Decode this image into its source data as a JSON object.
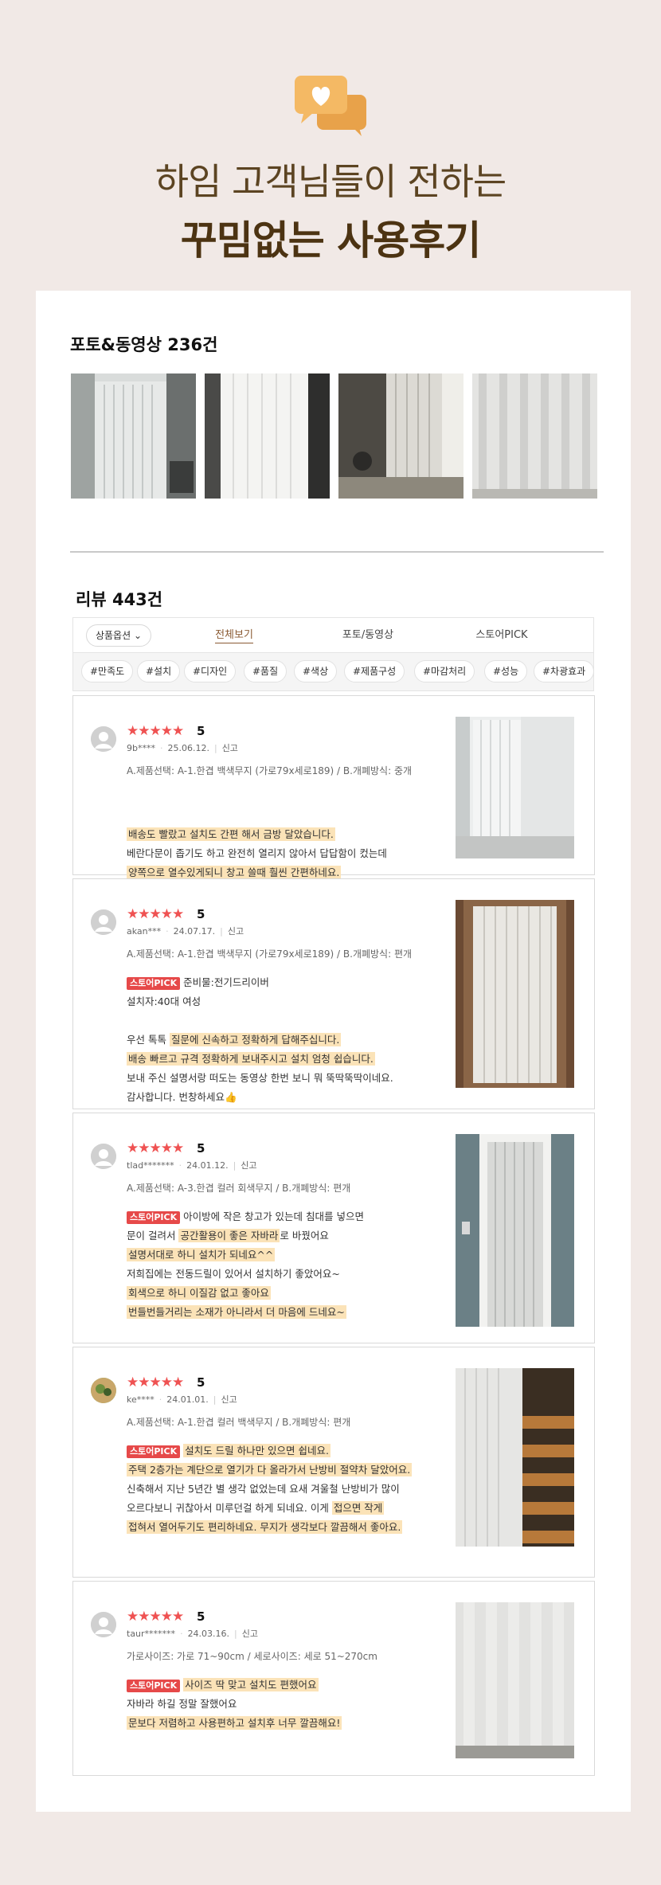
{
  "header": {
    "line1": "하임 고객님들이 전하는",
    "line2": "꾸밈없는 사용후기",
    "icon": "chat-heart-icon",
    "accent": "#f2b055"
  },
  "photos": {
    "label": "포토&동영상",
    "count": "236건"
  },
  "reviews_section": {
    "label": "리뷰",
    "count": "443건",
    "option_button": "상품옵션",
    "tabs": [
      "전체보기",
      "포토/동영상",
      "스토어PICK"
    ],
    "tags": [
      "#만족도",
      "#설치",
      "#디자인",
      "#품질",
      "#색상",
      "#제품구성",
      "#마감처리",
      "#성능",
      "#차광효과"
    ]
  },
  "reviews": [
    {
      "stars": "★★★★★",
      "score": "5",
      "user": "9b****",
      "date": "25.06.12.",
      "report": "신고",
      "option": "A.제품선택: A-1.한겹 백색무지 (가로79x세로189) / B.개폐방식: 중개",
      "lines": [
        {
          "pick": "",
          "parts": [
            {
              "t": "배송도 빨랐고 설치도 간편",
              "h": true
            },
            {
              "t": "해서 금방 달았습니다.",
              "h": true
            }
          ]
        },
        {
          "pick": "",
          "parts": [
            {
              "t": "베란다문이 좁기도 하고 완전히 열리지 않아서 답답함이 컸는데",
              "h": false
            }
          ]
        },
        {
          "pick": "",
          "parts": [
            {
              "t": "양쪽으로 열수있게되니 창고 쓸때 훨씬 간편하네요.",
              "h": true
            }
          ]
        }
      ]
    },
    {
      "stars": "★★★★★",
      "score": "5",
      "user": "akan***",
      "date": "24.07.17.",
      "report": "신고",
      "option": "A.제품선택: A-1.한겹 백색무지 (가로79x세로189) / B.개폐방식: 편개",
      "lines": [
        {
          "pick": "스토어PICK",
          "parts": [
            {
              "t": "준비물:전기드리이버",
              "h": false
            }
          ]
        },
        {
          "pick": "",
          "parts": [
            {
              "t": "설치자:40대 여성",
              "h": false
            }
          ]
        },
        {
          "pick": "",
          "parts": [
            {
              "t": "",
              "h": false
            }
          ]
        },
        {
          "pick": "",
          "parts": [
            {
              "t": "우선 톡톡 ",
              "h": false
            },
            {
              "t": "질문에 신속하고 정확하게 답해주십니다.",
              "h": true
            }
          ]
        },
        {
          "pick": "",
          "parts": [
            {
              "t": "배송 빠르고 규격 정확하게 보내주시고 설치 엄청 쉽습니다.",
              "h": true
            }
          ]
        },
        {
          "pick": "",
          "parts": [
            {
              "t": "보내 주신 설명서랑 떠도는 동영상 한번 보니 뭐 뚝딱뚝딱이네요.",
              "h": false
            }
          ]
        },
        {
          "pick": "",
          "parts": [
            {
              "t": "감사합니다. 번창하세요👍",
              "h": false
            }
          ]
        }
      ]
    },
    {
      "stars": "★★★★★",
      "score": "5",
      "user": "tlad*******",
      "date": "24.01.12.",
      "report": "신고",
      "option": "A.제품선택: A-3.한겹 컬러 회색무지 / B.개폐방식: 편개",
      "lines": [
        {
          "pick": "스토어PICK",
          "parts": [
            {
              "t": "아이방에 작은 창고가 있는데 침대를 넣으면",
              "h": false
            }
          ]
        },
        {
          "pick": "",
          "parts": [
            {
              "t": "문이 걸려서 ",
              "h": false
            },
            {
              "t": "공간활용이 좋은 자바라",
              "h": true
            },
            {
              "t": "로 바꿨어요",
              "h": false
            }
          ]
        },
        {
          "pick": "",
          "parts": [
            {
              "t": "설명서대로 하니 설치가 되네요^^",
              "h": true
            }
          ]
        },
        {
          "pick": "",
          "parts": [
            {
              "t": "저희집에는 전동드릴이 있어서 설치하기 좋았어요~",
              "h": false
            }
          ]
        },
        {
          "pick": "",
          "parts": [
            {
              "t": "회색으로 하니 이질감 없고 좋아요",
              "h": true
            }
          ]
        },
        {
          "pick": "",
          "parts": [
            {
              "t": "번들번들거리는 소재가 아니라서 더 마음에 드네요~",
              "h": true
            }
          ]
        }
      ]
    },
    {
      "stars": "★★★★★",
      "score": "5",
      "user": "ke****",
      "date": "24.01.01.",
      "report": "신고",
      "option": "A.제품선택: A-1.한겹 컬러 백색무지 / B.개폐방식: 편개",
      "lines": [
        {
          "pick": "스토어PICK",
          "parts": [
            {
              "t": "설치도 드릴 하나만 있으면 쉽네요.",
              "h": true
            }
          ]
        },
        {
          "pick": "",
          "parts": [
            {
              "t": "주택 2층가는 계단으로 열기가 다 올라가서 난방비 절약차 달았어요.",
              "h": true
            }
          ]
        },
        {
          "pick": "",
          "parts": [
            {
              "t": "신축해서 지난 5년간 별 생각 없었는데 요새 겨울철 난방비가 많이",
              "h": false
            }
          ]
        },
        {
          "pick": "",
          "parts": [
            {
              "t": "오르다보니 귀찮아서 미루던걸 하게 되네요. 이게 ",
              "h": false
            },
            {
              "t": "접으면 작게",
              "h": true
            }
          ]
        },
        {
          "pick": "",
          "parts": [
            {
              "t": "접혀서 열어두기도 편리하네요. 무지가 생각보다 깔끔해서 좋아요.",
              "h": true
            }
          ]
        }
      ]
    },
    {
      "stars": "★★★★★",
      "score": "5",
      "user": "taur*******",
      "date": "24.03.16.",
      "report": "신고",
      "option": "가로사이즈: 가로 71~90cm / 세로사이즈: 세로 51~270cm",
      "lines": [
        {
          "pick": "스토어PICK",
          "parts": [
            {
              "t": "사이즈 딱 맞고 설치도 편했어요",
              "h": true
            }
          ]
        },
        {
          "pick": "",
          "parts": [
            {
              "t": " 자바라 하길 정말 잘했어요",
              "h": false
            }
          ]
        },
        {
          "pick": "",
          "parts": [
            {
              "t": "문보다 저렴하고 사용편하고 설치후 너무 깔끔해요!",
              "h": true
            }
          ]
        }
      ]
    }
  ]
}
